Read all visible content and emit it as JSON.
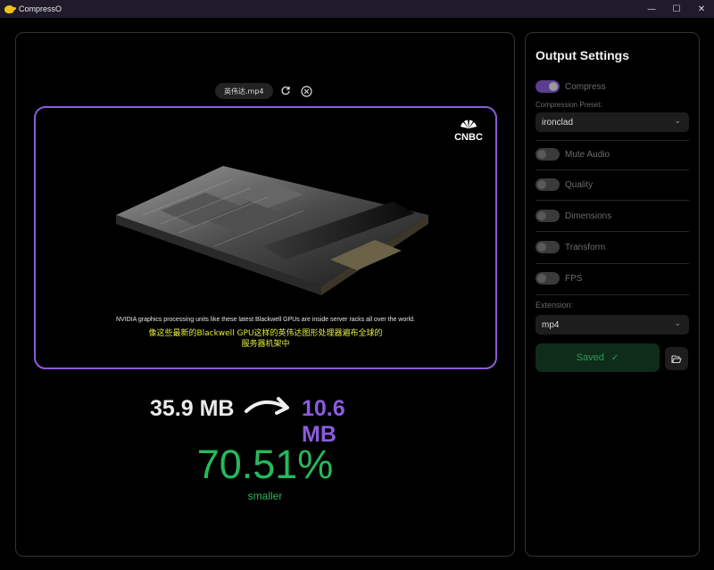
{
  "window": {
    "title": "CompressO",
    "controls": {
      "minimize": "—",
      "maximize": "☐",
      "close": "✕"
    }
  },
  "preview": {
    "filename": "英伟达.mp4",
    "watermark": "CNBC",
    "subtitle_en": "NVIDIA graphics processing units like these latest Blackwell GPUs are inside server racks all over the world.",
    "subtitle_zh_line1": "像这些最新的Blackwell GPU这样的英伟达图形处理器遍布全球的",
    "subtitle_zh_line2": "服务器机架中"
  },
  "result": {
    "original_size": "35.9 MB",
    "compressed_size": "10.6 MB",
    "percent": "70.51%",
    "percent_caption": "smaller"
  },
  "settings": {
    "title": "Output Settings",
    "compress": {
      "label": "Compress",
      "on": true
    },
    "preset_label": "Compression Preset:",
    "preset_value": "ironclad",
    "toggles": [
      {
        "label": "Mute Audio",
        "on": false
      },
      {
        "label": "Quality",
        "on": false
      },
      {
        "label": "Dimensions",
        "on": false
      },
      {
        "label": "Transform",
        "on": false
      },
      {
        "label": "FPS",
        "on": false
      }
    ],
    "extension_label": "Extension:",
    "extension_value": "mp4",
    "saved_label": "Saved"
  },
  "colors": {
    "accent_purple": "#8d5bd8",
    "success_green": "#26b95c",
    "subtitle_yellow": "#e5ec3b"
  },
  "icons": [
    "app-icon",
    "reload-icon",
    "close-circle-icon",
    "chevron-down-icon",
    "check-icon",
    "folder-open-icon",
    "arrow-right-icon"
  ]
}
